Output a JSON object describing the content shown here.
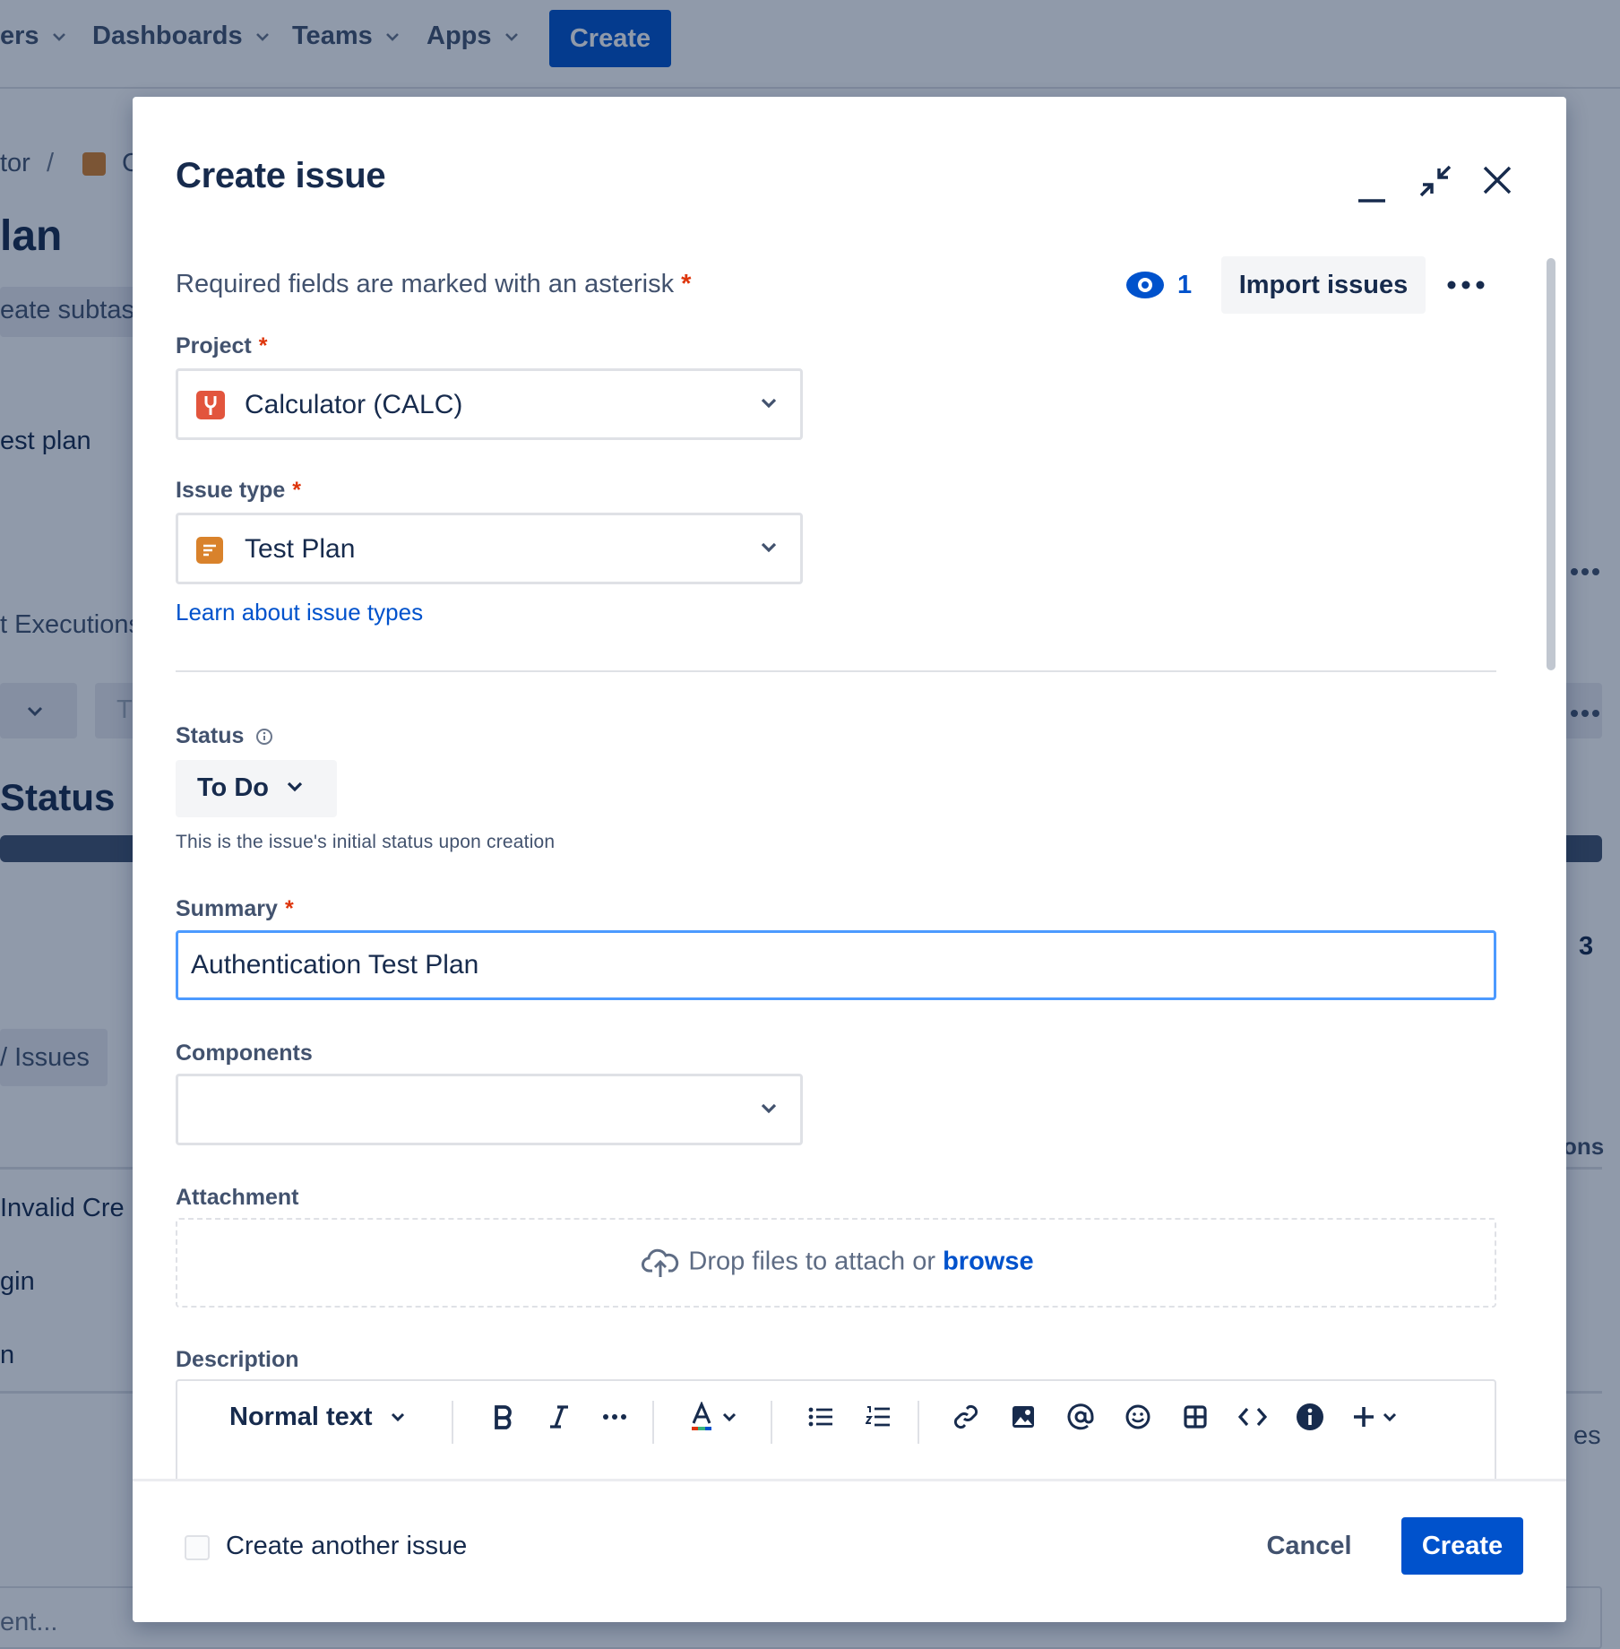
{
  "background": {
    "nav": {
      "partial_item": "ers",
      "items": [
        "Dashboards",
        "Teams",
        "Apps"
      ],
      "create_label": "Create"
    },
    "breadcrumb_partial": "tor",
    "breadcrumb_sep": "/",
    "breadcrumb_next_partial": "C",
    "page_title_partial": "lan",
    "create_subtask_partial": "eate subtas",
    "test_plan_partial": "est plan",
    "test_executions_partial": "t Executions",
    "select_partial": "T",
    "status_heading_partial": "Status",
    "issues_tab_partial": "/ Issues",
    "count_partial": "3",
    "actions_partial": "ons",
    "row1_partial": "Invalid Cre",
    "row2_partial": "gin",
    "row3_partial": "n",
    "right_partial_es": "es",
    "comment_partial": "ent..."
  },
  "modal": {
    "title": "Create issue",
    "required_note": "Required fields are marked with an asterisk",
    "asterisk": "*",
    "watchers_count": "1",
    "import_label": "Import issues",
    "fields": {
      "project": {
        "label": "Project",
        "value": "Calculator (CALC)"
      },
      "issue_type": {
        "label": "Issue type",
        "value": "Test Plan",
        "help_link": "Learn about issue types"
      },
      "status": {
        "label": "Status",
        "value": "To Do",
        "helper": "This is the issue's initial status upon creation"
      },
      "summary": {
        "label": "Summary",
        "value": "Authentication Test Plan"
      },
      "components": {
        "label": "Components",
        "value": ""
      },
      "attachment": {
        "label": "Attachment",
        "drop_text": "Drop files to attach or",
        "browse": "browse"
      },
      "description": {
        "label": "Description",
        "text_style": "Normal text"
      }
    },
    "footer": {
      "create_another": "Create another issue",
      "cancel": "Cancel",
      "create": "Create"
    }
  },
  "colors": {
    "primary": "#0052CC",
    "focus_border": "#4C9AFF",
    "required_star": "#DE350B",
    "project_icon": "#E2553D",
    "issue_type_icon": "#D9822B"
  }
}
